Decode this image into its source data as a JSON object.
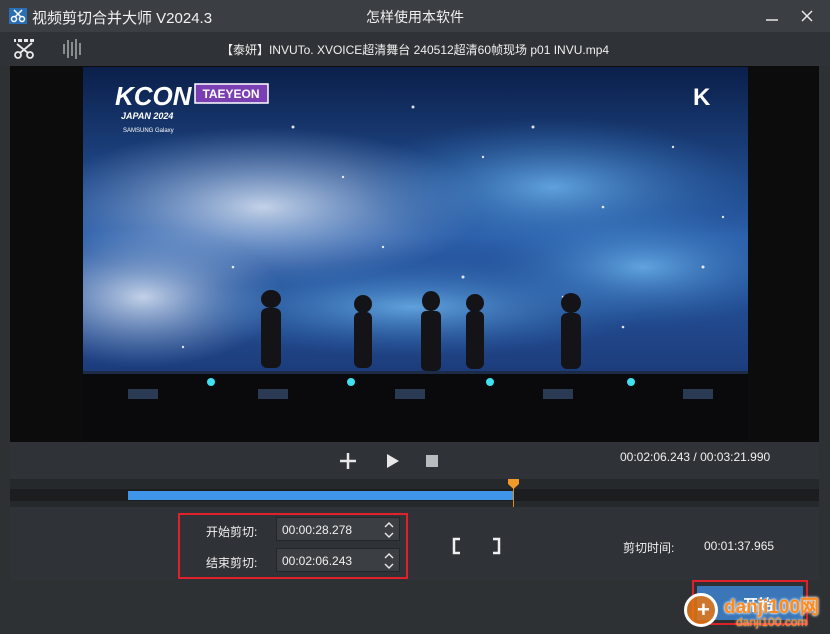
{
  "window": {
    "title": "视频剪切合并大师 V2024.3",
    "help_link": "怎样使用本软件"
  },
  "toolbar": {
    "file_name": "【泰妍】INVUTo. XVOICE超清舞台 240512超清60帧现场 p01 INVU.mp4",
    "icons": [
      "cut-tool-icon",
      "waveform-tool-icon"
    ]
  },
  "video_frame": {
    "logo_main": "KCON",
    "logo_sub": "JAPAN 2024",
    "sponsor": "SAMSUNG Galaxy",
    "artist_tag": "TAEYEON",
    "corner_logo": "K"
  },
  "playback": {
    "current_time": "00:02:06.243",
    "total_time": "00:03:21.990",
    "separator": "/",
    "progress_fraction": 0.625
  },
  "cut": {
    "start_label": "开始剪切:",
    "start_value": "00:00:28.278",
    "end_label": "结束剪切:",
    "end_value": "00:02:06.243",
    "duration_label": "剪切时间:",
    "duration_value": "00:01:37.965"
  },
  "actions": {
    "start_label": "开始"
  },
  "watermark": {
    "site_name": "danji100网",
    "site_url": "danji100.com"
  },
  "colors": {
    "accent_blue": "#3f95e9",
    "playhead_orange": "#e68a1c",
    "highlight_red": "#e0212a",
    "button_blue": "#3a76b8"
  }
}
